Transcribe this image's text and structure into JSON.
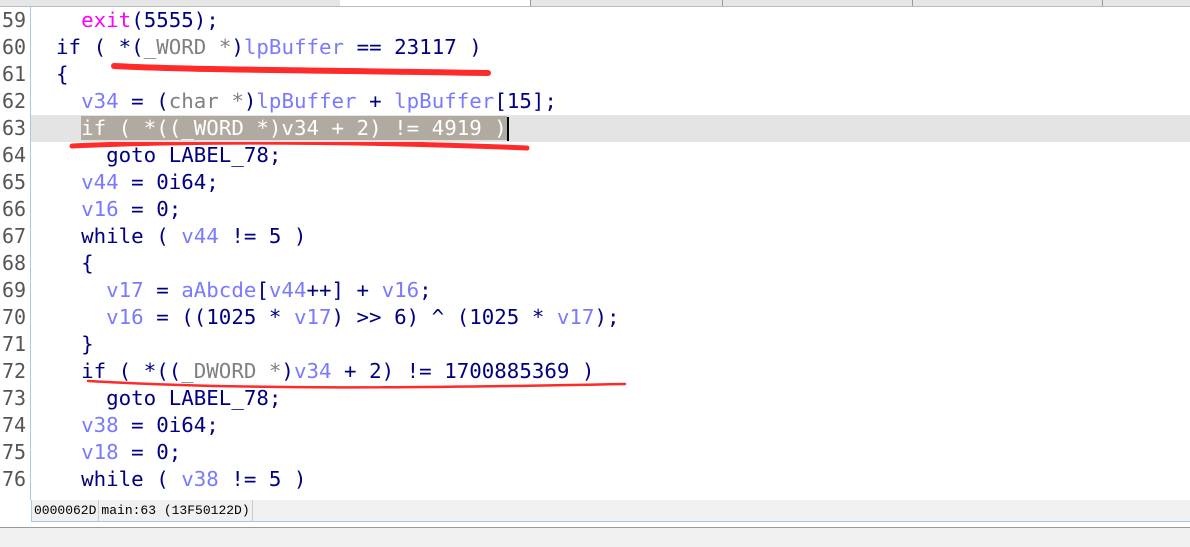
{
  "colors": {
    "keyword": "#000080",
    "variable": "#7a7aff",
    "cast": "#808080",
    "function": "#ff00ff",
    "highlight": "#b0aaa0",
    "annotation": "#ff2a2a"
  },
  "current_line": 63,
  "lines": [
    {
      "n": "59",
      "t": [
        [
          "    ",
          ""
        ],
        [
          "exit",
          "f"
        ],
        [
          "(5555);",
          "p"
        ]
      ]
    },
    {
      "n": "60",
      "t": [
        [
          "  if ( ",
          "k"
        ],
        [
          "*(",
          "p"
        ],
        [
          "_WORD *",
          "c"
        ],
        [
          ")",
          "p"
        ],
        [
          "lpBuffer",
          "v"
        ],
        [
          " == 23117 )",
          "p"
        ]
      ]
    },
    {
      "n": "61",
      "t": [
        [
          "  {",
          "p"
        ]
      ]
    },
    {
      "n": "62",
      "t": [
        [
          "    ",
          ""
        ],
        [
          "v34",
          "v"
        ],
        [
          " = (",
          "p"
        ],
        [
          "char *",
          "c"
        ],
        [
          ")",
          "p"
        ],
        [
          "lpBuffer",
          "v"
        ],
        [
          " + ",
          "p"
        ],
        [
          "lpBuffer",
          "v"
        ],
        [
          "[15];",
          "p"
        ]
      ]
    },
    {
      "n": "63",
      "t": [
        [
          "    ",
          ""
        ],
        [
          "if ( *((_WORD *)v34 + 2) != 4919 )",
          "sel"
        ]
      ]
    },
    {
      "n": "64",
      "t": [
        [
          "      goto LABEL_78;",
          "k"
        ]
      ]
    },
    {
      "n": "65",
      "t": [
        [
          "    ",
          ""
        ],
        [
          "v44",
          "v"
        ],
        [
          " = 0i64;",
          "p"
        ]
      ]
    },
    {
      "n": "66",
      "t": [
        [
          "    ",
          ""
        ],
        [
          "v16",
          "v"
        ],
        [
          " = 0;",
          "p"
        ]
      ]
    },
    {
      "n": "67",
      "t": [
        [
          "    while ( ",
          "k"
        ],
        [
          "v44",
          "v"
        ],
        [
          " != 5 )",
          "p"
        ]
      ]
    },
    {
      "n": "68",
      "t": [
        [
          "    {",
          "p"
        ]
      ]
    },
    {
      "n": "69",
      "t": [
        [
          "      ",
          ""
        ],
        [
          "v17",
          "v"
        ],
        [
          " = ",
          "p"
        ],
        [
          "aAbcde",
          "v"
        ],
        [
          "[",
          "p"
        ],
        [
          "v44",
          "v"
        ],
        [
          "++] + ",
          "p"
        ],
        [
          "v16",
          "v"
        ],
        [
          ";",
          "p"
        ]
      ]
    },
    {
      "n": "70",
      "t": [
        [
          "      ",
          ""
        ],
        [
          "v16",
          "v"
        ],
        [
          " = ((1025 * ",
          "p"
        ],
        [
          "v17",
          "v"
        ],
        [
          ") >> 6) ^ (1025 * ",
          "p"
        ],
        [
          "v17",
          "v"
        ],
        [
          ");",
          "p"
        ]
      ]
    },
    {
      "n": "71",
      "t": [
        [
          "    }",
          "p"
        ]
      ]
    },
    {
      "n": "72",
      "t": [
        [
          "    if ( ",
          "k"
        ],
        [
          "*((",
          "p"
        ],
        [
          "_DWORD *",
          "c"
        ],
        [
          ")",
          "p"
        ],
        [
          "v34",
          "v"
        ],
        [
          " + 2) != 1700885369 )",
          "p"
        ]
      ]
    },
    {
      "n": "73",
      "t": [
        [
          "      goto LABEL_78;",
          "k"
        ]
      ]
    },
    {
      "n": "74",
      "t": [
        [
          "    ",
          ""
        ],
        [
          "v38",
          "v"
        ],
        [
          " = 0i64;",
          "p"
        ]
      ]
    },
    {
      "n": "75",
      "t": [
        [
          "    ",
          ""
        ],
        [
          "v18",
          "v"
        ],
        [
          " = 0;",
          "p"
        ]
      ]
    },
    {
      "n": "76",
      "t": [
        [
          "    while ( ",
          "k"
        ],
        [
          "v38",
          "v"
        ],
        [
          " != 5 )",
          "p"
        ]
      ]
    }
  ],
  "status": {
    "offset": "0000062D",
    "location": "main:63 (13F50122D)",
    "extra": ""
  }
}
